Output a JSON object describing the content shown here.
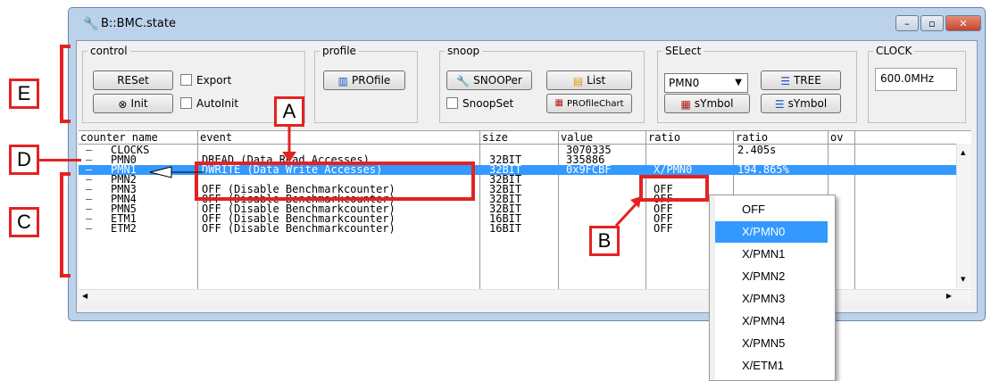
{
  "window": {
    "title": "B::BMC.state",
    "min": "–",
    "max": "▫",
    "close": "✕"
  },
  "control": {
    "legend": "control",
    "reset": "RESet",
    "init": "Init",
    "export": "Export",
    "autoinit": "AutoInit"
  },
  "profile": {
    "legend": "profile",
    "profile_btn": "PROfile"
  },
  "snoop": {
    "legend": "snoop",
    "snooper": "SNOOPer",
    "list": "List",
    "snoopset": "SnoopSet",
    "profilechart": "PROfileChart"
  },
  "select": {
    "legend": "SELect",
    "dropdown_value": "PMN0",
    "tree": "TREE",
    "symbol1": "sYmbol",
    "symbol2": "sYmbol"
  },
  "clock": {
    "legend": "CLOCK",
    "value": "600.0MHz"
  },
  "table": {
    "headers": [
      "counter name",
      "event",
      "size",
      "value",
      "ratio",
      "ratio",
      "ov"
    ],
    "rows": [
      {
        "name": "CLOCKS",
        "event": "",
        "size": "",
        "value": "3070335",
        "ratio1": "",
        "ratio2": "2.405s"
      },
      {
        "name": "PMN0",
        "event": "DREAD (Data Read Accesses)",
        "size": "32BIT",
        "value": "335886",
        "ratio1": "",
        "ratio2": ""
      },
      {
        "name": "PMN1",
        "event": "DWRITE (Data Write Accesses)",
        "size": "32BIT",
        "value": "0x9FCBF",
        "ratio1": "X/PMN0",
        "ratio2": "194.865%"
      },
      {
        "name": "PMN2",
        "event": "",
        "size": "32BIT",
        "value": "",
        "ratio1": "",
        "ratio2": ""
      },
      {
        "name": "PMN3",
        "event": "OFF (Disable Benchmarkcounter)",
        "size": "32BIT",
        "value": "",
        "ratio1": "OFF",
        "ratio2": ""
      },
      {
        "name": "PMN4",
        "event": "OFF (Disable Benchmarkcounter)",
        "size": "32BIT",
        "value": "",
        "ratio1": "OFF",
        "ratio2": ""
      },
      {
        "name": "PMN5",
        "event": "OFF (Disable Benchmarkcounter)",
        "size": "32BIT",
        "value": "",
        "ratio1": "OFF",
        "ratio2": ""
      },
      {
        "name": "ETM1",
        "event": "OFF (Disable Benchmarkcounter)",
        "size": "16BIT",
        "value": "",
        "ratio1": "OFF",
        "ratio2": ""
      },
      {
        "name": "ETM2",
        "event": "OFF (Disable Benchmarkcounter)",
        "size": "16BIT",
        "value": "",
        "ratio1": "OFF",
        "ratio2": ""
      }
    ]
  },
  "popup": {
    "items": [
      "OFF",
      "X/PMN0",
      "X/PMN1",
      "X/PMN2",
      "X/PMN3",
      "X/PMN4",
      "X/PMN5",
      "X/ETM1"
    ],
    "highlighted": "X/PMN0"
  },
  "annotations": {
    "A": "A",
    "B": "B",
    "C": "C",
    "D": "D",
    "E": "E"
  },
  "colors": {
    "annotation": "#e32222",
    "selection": "#3399ff",
    "window_frame": "#bcd2ea"
  }
}
